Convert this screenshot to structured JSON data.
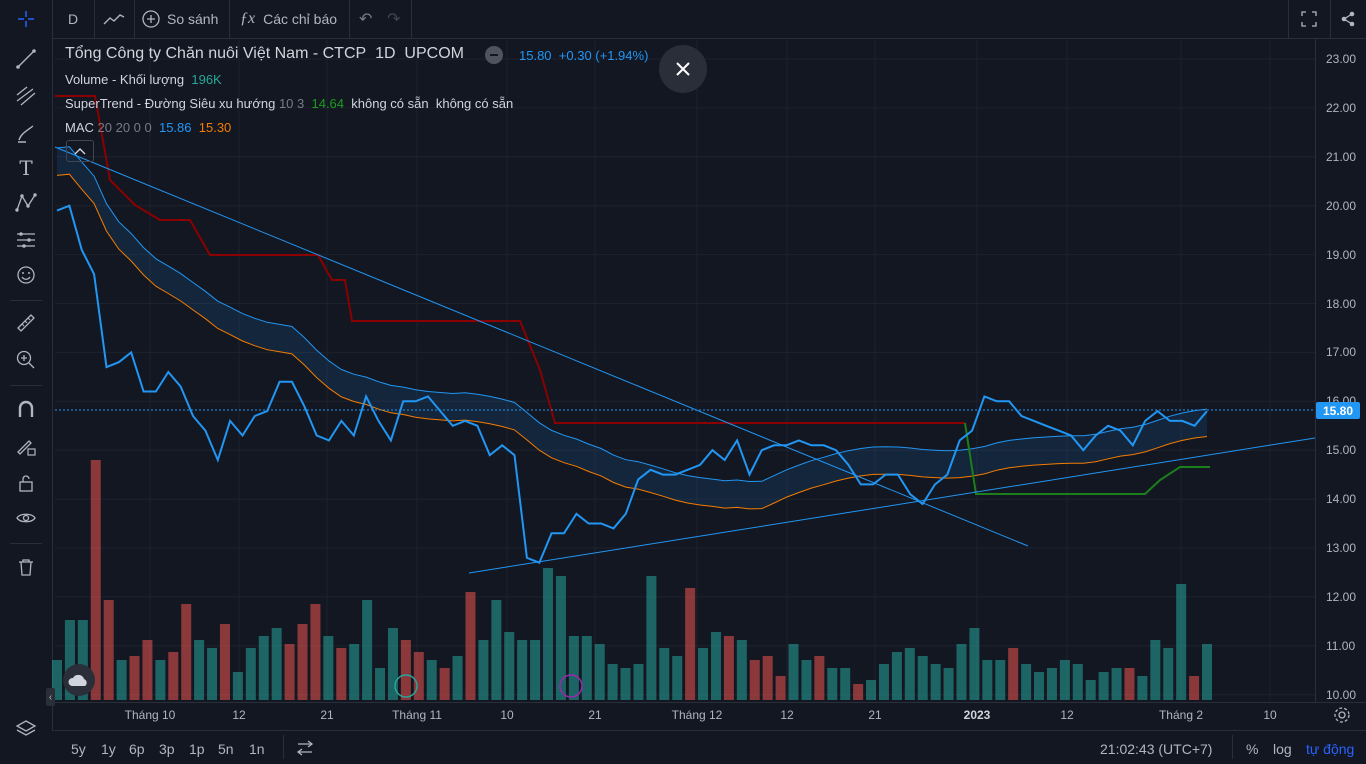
{
  "toolbar": {
    "interval": "D",
    "compare_label": "So sánh",
    "indicators_label": "Các chỉ báo"
  },
  "legend": {
    "symbol_title": "Tổng Công ty Chăn nuôi Việt Nam - CTCP",
    "timeframe": "1D",
    "exchange": "UPCOM",
    "price": "15.80",
    "change": "+0.30 (+1.94%)",
    "volume_name": "Volume - Khối lượng",
    "volume_value": "196K",
    "supertrend_name": "SuperTrend - Đường Siêu xu hướng",
    "supertrend_params": "10 3",
    "supertrend_value": "14.64",
    "supertrend_na1": "không có sẵn",
    "supertrend_na2": "không có sẵn",
    "mac_name": "MAC",
    "mac_params": "20 20 0 0",
    "mac_upper": "15.86",
    "mac_lower": "15.30"
  },
  "price_axis": {
    "ticks": [
      "23.00",
      "22.00",
      "21.00",
      "20.00",
      "19.00",
      "18.00",
      "17.00",
      "16.00",
      "15.00",
      "14.00",
      "13.00",
      "12.00",
      "11.00",
      "10.00"
    ],
    "last_price": "15.80"
  },
  "time_axis": {
    "ticks": [
      "Tháng 10",
      "12",
      "21",
      "Tháng 11",
      "10",
      "21",
      "Tháng 12",
      "12",
      "21",
      "2023",
      "12",
      "Tháng 2",
      "10"
    ]
  },
  "bottom": {
    "ranges": [
      "5y",
      "1y",
      "6p",
      "3p",
      "1p",
      "5n",
      "1n"
    ],
    "clock": "21:02:43 (UTC+7)",
    "percent": "%",
    "log": "log",
    "auto": "tự động"
  },
  "colors": {
    "background": "#131722",
    "price_line": "#2196f3",
    "up_volume": "#26a69a",
    "down_volume": "#ef5350",
    "supertrend_down": "#8b0000",
    "supertrend_up": "#1b7f1b",
    "mac_lower": "#f57c00"
  },
  "chart_data": {
    "type": "line",
    "ylim": [
      10,
      23
    ],
    "price": [
      19.9,
      20.0,
      19.1,
      18.6,
      16.7,
      16.8,
      17.0,
      16.2,
      16.2,
      16.6,
      16.3,
      15.7,
      15.4,
      14.8,
      15.6,
      15.3,
      15.7,
      15.8,
      16.4,
      16.4,
      15.9,
      15.3,
      15.2,
      15.6,
      15.3,
      16.1,
      15.6,
      15.2,
      16.0,
      16.0,
      16.1,
      15.8,
      15.5,
      15.6,
      15.5,
      14.9,
      15.1,
      14.9,
      12.8,
      12.7,
      13.3,
      13.3,
      13.7,
      13.5,
      13.5,
      13.4,
      13.7,
      14.4,
      14.6,
      14.5,
      14.5,
      14.6,
      14.7,
      15.0,
      14.8,
      15.2,
      14.5,
      15.0,
      15.1,
      15.1,
      15.2,
      15.1,
      15.1,
      15.0,
      14.7,
      14.3,
      14.3,
      14.5,
      14.5,
      14.1,
      13.9,
      14.3,
      14.5,
      15.2,
      15.4,
      16.1,
      16.0,
      16.0,
      15.7,
      15.6,
      15.5,
      15.4,
      15.3,
      15.0,
      15.3,
      15.5,
      15.4,
      15.1,
      15.6,
      15.8,
      15.6,
      15.6,
      15.5,
      15.8
    ],
    "volume": [
      [
        0,
        1,
        "up"
      ],
      [
        1,
        2,
        "up"
      ],
      [
        2,
        2,
        "up"
      ],
      [
        3,
        6,
        "down"
      ],
      [
        4,
        2.5,
        "down"
      ],
      [
        5,
        1,
        "up"
      ],
      [
        6,
        1.1,
        "down"
      ],
      [
        7,
        1.5,
        "down"
      ],
      [
        8,
        1,
        "up"
      ],
      [
        9,
        1.2,
        "down"
      ],
      [
        10,
        2.4,
        "down"
      ],
      [
        11,
        1.5,
        "up"
      ],
      [
        12,
        1.3,
        "up"
      ],
      [
        13,
        1.9,
        "down"
      ],
      [
        14,
        0.7,
        "up"
      ],
      [
        15,
        1.3,
        "up"
      ],
      [
        16,
        1.6,
        "up"
      ],
      [
        17,
        1.8,
        "up"
      ],
      [
        18,
        1.4,
        "down"
      ],
      [
        19,
        1.9,
        "down"
      ],
      [
        20,
        2.4,
        "down"
      ],
      [
        21,
        1.6,
        "up"
      ],
      [
        22,
        1.3,
        "down"
      ],
      [
        23,
        1.4,
        "up"
      ],
      [
        24,
        2.5,
        "up"
      ],
      [
        25,
        0.8,
        "up"
      ],
      [
        26,
        1.8,
        "up"
      ],
      [
        27,
        1.5,
        "down"
      ],
      [
        28,
        1.2,
        "down"
      ],
      [
        29,
        1.0,
        "up"
      ],
      [
        30,
        0.8,
        "down"
      ],
      [
        31,
        1.1,
        "up"
      ],
      [
        32,
        2.7,
        "down"
      ],
      [
        33,
        1.5,
        "up"
      ],
      [
        34,
        2.5,
        "up"
      ],
      [
        35,
        1.7,
        "up"
      ],
      [
        36,
        1.5,
        "up"
      ],
      [
        37,
        1.5,
        "up"
      ],
      [
        38,
        3.3,
        "up"
      ],
      [
        39,
        3.1,
        "up"
      ],
      [
        40,
        1.6,
        "up"
      ],
      [
        41,
        1.6,
        "up"
      ],
      [
        42,
        1.4,
        "up"
      ],
      [
        43,
        0.9,
        "up"
      ],
      [
        44,
        0.8,
        "up"
      ],
      [
        45,
        0.9,
        "up"
      ],
      [
        46,
        3.1,
        "up"
      ],
      [
        47,
        1.3,
        "up"
      ],
      [
        48,
        1.1,
        "up"
      ],
      [
        49,
        2.8,
        "down"
      ],
      [
        50,
        1.3,
        "up"
      ],
      [
        51,
        1.7,
        "up"
      ],
      [
        52,
        1.6,
        "down"
      ],
      [
        53,
        1.5,
        "up"
      ],
      [
        54,
        1.0,
        "down"
      ],
      [
        55,
        1.1,
        "down"
      ],
      [
        56,
        0.6,
        "down"
      ],
      [
        57,
        1.4,
        "up"
      ],
      [
        58,
        1.0,
        "up"
      ],
      [
        59,
        1.1,
        "down"
      ],
      [
        60,
        0.8,
        "up"
      ],
      [
        61,
        0.8,
        "up"
      ],
      [
        62,
        0.4,
        "down"
      ],
      [
        63,
        0.5,
        "up"
      ],
      [
        64,
        0.9,
        "up"
      ],
      [
        65,
        1.2,
        "up"
      ],
      [
        66,
        1.3,
        "up"
      ],
      [
        67,
        1.1,
        "up"
      ],
      [
        68,
        0.9,
        "up"
      ],
      [
        69,
        0.8,
        "up"
      ],
      [
        70,
        1.4,
        "up"
      ],
      [
        71,
        1.8,
        "up"
      ],
      [
        72,
        1.0,
        "up"
      ],
      [
        73,
        1.0,
        "up"
      ],
      [
        74,
        1.3,
        "down"
      ],
      [
        75,
        0.9,
        "up"
      ],
      [
        76,
        0.7,
        "up"
      ],
      [
        77,
        0.8,
        "up"
      ],
      [
        78,
        1.0,
        "up"
      ],
      [
        79,
        0.9,
        "up"
      ],
      [
        80,
        0.5,
        "up"
      ],
      [
        81,
        0.7,
        "up"
      ],
      [
        82,
        0.8,
        "up"
      ],
      [
        83,
        0.8,
        "down"
      ],
      [
        84,
        0.6,
        "up"
      ],
      [
        85,
        1.5,
        "up"
      ],
      [
        86,
        1.3,
        "up"
      ],
      [
        87,
        2.9,
        "up"
      ],
      [
        88,
        0.6,
        "down"
      ],
      [
        89,
        1.4,
        "up"
      ]
    ]
  }
}
